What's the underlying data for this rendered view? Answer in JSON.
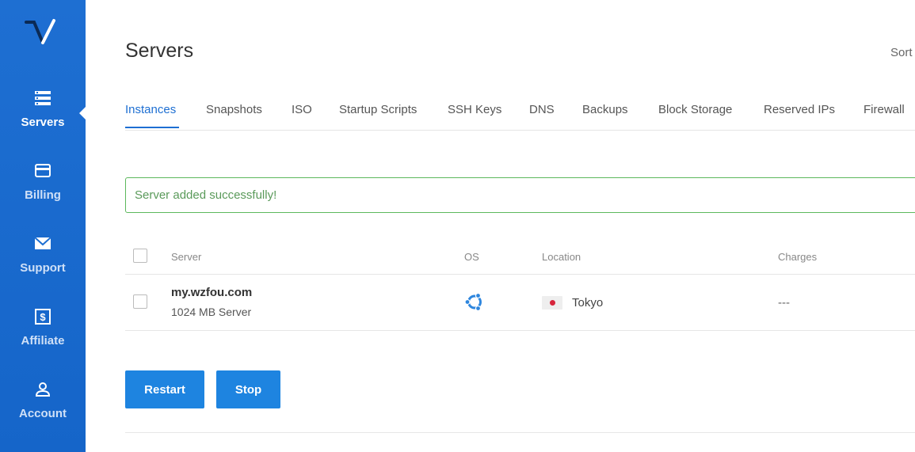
{
  "sidebar": {
    "items": [
      {
        "label": "Servers",
        "icon": "server-list-icon",
        "active": true
      },
      {
        "label": "Billing",
        "icon": "credit-card-icon",
        "active": false
      },
      {
        "label": "Support",
        "icon": "envelope-icon",
        "active": false
      },
      {
        "label": "Affiliate",
        "icon": "dollar-bill-icon",
        "active": false
      },
      {
        "label": "Account",
        "icon": "user-icon",
        "active": false
      }
    ]
  },
  "header": {
    "title": "Servers",
    "sort_label": "Sort"
  },
  "tabs": [
    {
      "label": "Instances",
      "active": true
    },
    {
      "label": "Snapshots"
    },
    {
      "label": "ISO"
    },
    {
      "label": "Startup Scripts"
    },
    {
      "label": "SSH Keys"
    },
    {
      "label": "DNS"
    },
    {
      "label": "Backups"
    },
    {
      "label": "Block Storage"
    },
    {
      "label": "Reserved IPs"
    },
    {
      "label": "Firewall"
    }
  ],
  "alert": {
    "message": "Server added successfully!"
  },
  "table": {
    "columns": [
      "Server",
      "OS",
      "Location",
      "Charges"
    ],
    "rows": [
      {
        "name": "my.wzfou.com",
        "plan": "1024 MB Server",
        "os": "ubuntu-icon",
        "location": "Tokyo",
        "charges": "---"
      }
    ]
  },
  "actions": {
    "restart": "Restart",
    "stop": "Stop"
  },
  "colors": {
    "sidebar": "#1e6fd2",
    "accent": "#1e84e0",
    "success_border": "#5cb85c"
  }
}
